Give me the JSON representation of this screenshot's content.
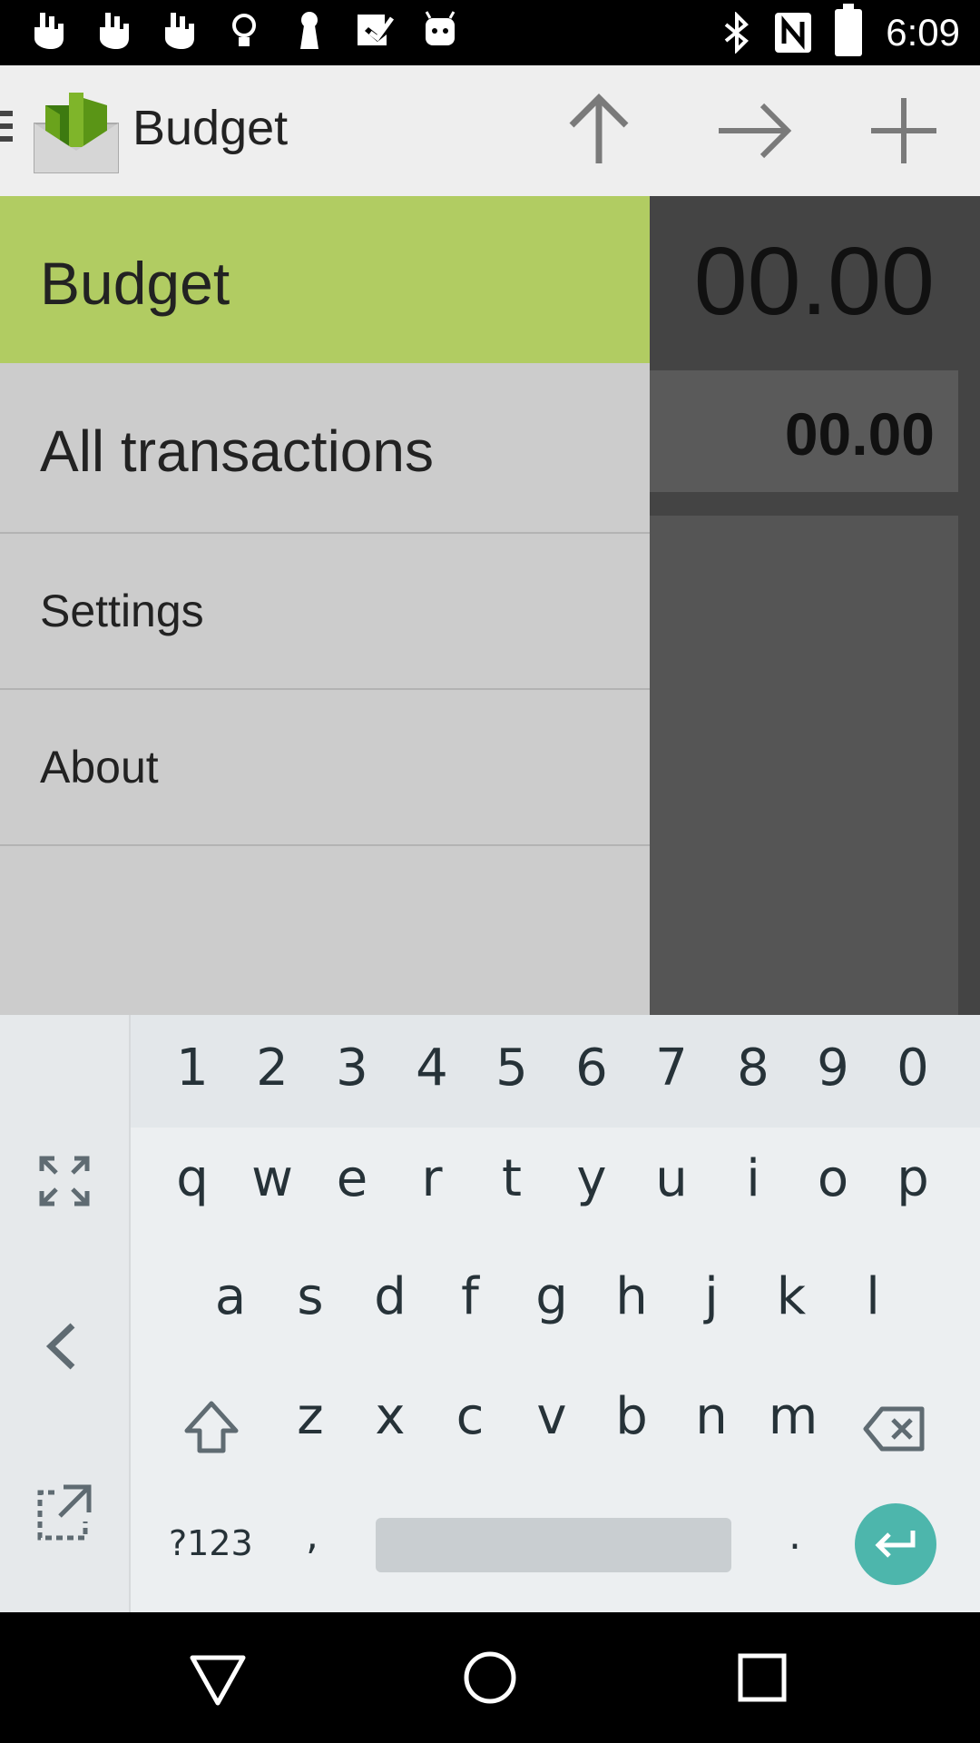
{
  "status_bar": {
    "time": "6:09",
    "left_icons": [
      "hand-icon",
      "hand-icon",
      "hand-icon",
      "bulb-icon",
      "keyhole-icon",
      "check-icon",
      "android-icon"
    ],
    "right_icons": [
      "bluetooth-icon",
      "nfc-icon",
      "battery-icon"
    ]
  },
  "app_bar": {
    "title": "Budget",
    "actions": [
      "arrow-up-icon",
      "arrow-right-icon",
      "plus-icon"
    ]
  },
  "main": {
    "big_amount": "00.00",
    "card_amount": "00.00"
  },
  "drawer": {
    "items": [
      {
        "label": "Budget",
        "active": true
      },
      {
        "label": "All transactions",
        "active": false
      },
      {
        "label": "Settings",
        "active": false
      },
      {
        "label": "About",
        "active": false
      }
    ]
  },
  "keyboard": {
    "number_row": [
      "1",
      "2",
      "3",
      "4",
      "5",
      "6",
      "7",
      "8",
      "9",
      "0"
    ],
    "row1": [
      "q",
      "w",
      "e",
      "r",
      "t",
      "y",
      "u",
      "i",
      "o",
      "p"
    ],
    "row2": [
      "a",
      "s",
      "d",
      "f",
      "g",
      "h",
      "j",
      "k",
      "l"
    ],
    "row3": [
      "z",
      "x",
      "c",
      "v",
      "b",
      "n",
      "m"
    ],
    "symbols_key": "?123",
    "comma_key": ",",
    "period_key": ".",
    "accent_color": "#4db6ac"
  },
  "colors": {
    "drawer_active": "#b1cc62",
    "drawer_bg": "#cccccc",
    "appbar_bg": "#eeeeee"
  }
}
